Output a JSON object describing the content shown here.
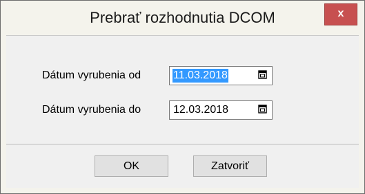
{
  "window": {
    "title": "Prebrať rozhodnutia DCOM",
    "close_label": "x",
    "close_icon": "close-icon"
  },
  "form": {
    "rows": [
      {
        "label": "Dátum vyrubenia od",
        "value": "11.03.2018",
        "selected": true,
        "icon": "calendar-icon"
      },
      {
        "label": "Dátum vyrubenia do",
        "value": "12.03.2018",
        "selected": false,
        "icon": "calendar-icon"
      }
    ]
  },
  "buttons": {
    "ok_label": "OK",
    "close_label": "Zatvoriť"
  },
  "colors": {
    "close_button": "#c75050",
    "selection": "#3399ff"
  }
}
